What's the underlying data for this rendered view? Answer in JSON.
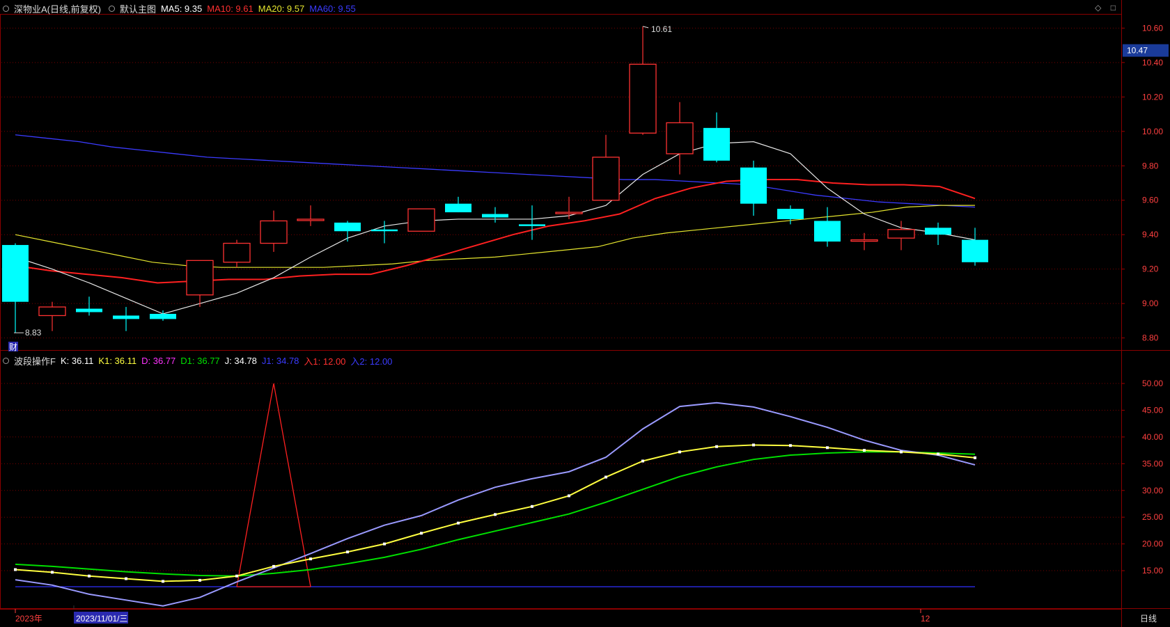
{
  "main_legend": {
    "title": "深物业A(日线,前复权)",
    "template": "默认主图",
    "ma5": "MA5: 9.35",
    "ma10": "MA10: 9.61",
    "ma20": "MA20: 9.57",
    "ma60": "MA60: 9.55"
  },
  "sub_legend": {
    "title": "波段操作F",
    "k": "K: 36.11",
    "k1": "K1: 36.11",
    "d": "D: 36.77",
    "d1": "D1: 36.77",
    "j": "J: 34.78",
    "j1": "J1: 34.78",
    "in1": "入1: 12.00",
    "in2": "入2: 12.00"
  },
  "corner_icons": [
    "diamond-icon",
    "square-icon"
  ],
  "colors": {
    "up": "#ff3232",
    "down": "#00ffff",
    "ma5": "#ffffff",
    "ma10": "#ff2020",
    "ma20": "#e6e62e",
    "ma60": "#3b3bff",
    "k": "#ffff40",
    "d": "#00e000",
    "j": "#9a9aff",
    "in1": "#ff2020",
    "in2": "#3030ff"
  },
  "annotations": {
    "high": "10.61",
    "low": "8.83",
    "finance_mark": "财",
    "current_price": "10.47"
  },
  "footer": {
    "year": "2023年",
    "date": "2023/11/01/三",
    "month": "12",
    "period": "日线"
  },
  "chart_data": [
    {
      "type": "candlestick",
      "ylim": [
        8.75,
        10.65
      ],
      "yticks": [
        "8.80",
        "9.00",
        "9.20",
        "9.40",
        "9.60",
        "9.80",
        "10.00",
        "10.20",
        "10.40",
        "10.60"
      ],
      "candles": [
        {
          "o": 9.34,
          "h": 9.35,
          "l": 8.83,
          "c": 9.01
        },
        {
          "o": 8.93,
          "h": 9.01,
          "l": 8.84,
          "c": 8.98
        },
        {
          "o": 8.97,
          "h": 9.04,
          "l": 8.93,
          "c": 8.95
        },
        {
          "o": 8.93,
          "h": 8.98,
          "l": 8.84,
          "c": 8.91
        },
        {
          "o": 8.94,
          "h": 8.96,
          "l": 8.9,
          "c": 8.91
        },
        {
          "o": 9.05,
          "h": 9.25,
          "l": 8.98,
          "c": 9.25
        },
        {
          "o": 9.24,
          "h": 9.37,
          "l": 9.21,
          "c": 9.35
        },
        {
          "o": 9.35,
          "h": 9.54,
          "l": 9.3,
          "c": 9.48
        },
        {
          "o": 9.49,
          "h": 9.57,
          "l": 9.45,
          "c": 9.49
        },
        {
          "o": 9.47,
          "h": 9.48,
          "l": 9.36,
          "c": 9.42
        },
        {
          "o": 9.43,
          "h": 9.48,
          "l": 9.35,
          "c": 9.42
        },
        {
          "o": 9.42,
          "h": 9.55,
          "l": 9.42,
          "c": 9.55
        },
        {
          "o": 9.58,
          "h": 9.62,
          "l": 9.53,
          "c": 9.53
        },
        {
          "o": 9.52,
          "h": 9.56,
          "l": 9.47,
          "c": 9.5
        },
        {
          "o": 9.46,
          "h": 9.57,
          "l": 9.37,
          "c": 9.45
        },
        {
          "o": 9.53,
          "h": 9.62,
          "l": 9.49,
          "c": 9.53
        },
        {
          "o": 9.6,
          "h": 9.98,
          "l": 9.6,
          "c": 9.85
        },
        {
          "o": 9.99,
          "h": 10.61,
          "l": 9.98,
          "c": 10.39
        },
        {
          "o": 9.87,
          "h": 10.17,
          "l": 9.75,
          "c": 10.05
        },
        {
          "o": 10.02,
          "h": 10.11,
          "l": 9.82,
          "c": 9.83
        },
        {
          "o": 9.79,
          "h": 9.83,
          "l": 9.51,
          "c": 9.58
        },
        {
          "o": 9.55,
          "h": 9.57,
          "l": 9.46,
          "c": 9.49
        },
        {
          "o": 9.48,
          "h": 9.56,
          "l": 9.33,
          "c": 9.36
        },
        {
          "o": 9.37,
          "h": 9.41,
          "l": 9.31,
          "c": 9.37
        },
        {
          "o": 9.38,
          "h": 9.48,
          "l": 9.31,
          "c": 9.43
        },
        {
          "o": 9.44,
          "h": 9.47,
          "l": 9.34,
          "c": 9.4
        },
        {
          "o": 9.37,
          "h": 9.44,
          "l": 9.22,
          "c": 9.24
        }
      ],
      "ma5": [
        9.27,
        9.2,
        9.12,
        9.03,
        8.94,
        9.0,
        9.06,
        9.15,
        9.27,
        9.38,
        9.45,
        9.48,
        9.49,
        9.49,
        9.49,
        9.51,
        9.57,
        9.75,
        9.87,
        9.93,
        9.94,
        9.87,
        9.67,
        9.52,
        9.44,
        9.41,
        9.37
      ],
      "ma10": [
        9.22,
        9.19,
        9.17,
        9.15,
        9.12,
        9.13,
        9.14,
        9.14,
        9.16,
        9.17,
        9.17,
        9.22,
        9.28,
        9.34,
        9.4,
        9.45,
        9.48,
        9.52,
        9.61,
        9.67,
        9.71,
        9.72,
        9.72,
        9.7,
        9.69,
        9.69,
        9.68,
        9.61
      ],
      "ma20": [
        9.4,
        9.36,
        9.32,
        9.28,
        9.24,
        9.22,
        9.21,
        9.21,
        9.21,
        9.21,
        9.22,
        9.23,
        9.25,
        9.26,
        9.27,
        9.29,
        9.31,
        9.33,
        9.38,
        9.41,
        9.43,
        9.45,
        9.47,
        9.49,
        9.51,
        9.53,
        9.56,
        9.57,
        9.57
      ],
      "ma60": [
        9.98,
        9.96,
        9.94,
        9.91,
        9.89,
        9.87,
        9.85,
        9.84,
        9.83,
        9.82,
        9.81,
        9.8,
        9.79,
        9.78,
        9.77,
        9.76,
        9.75,
        9.74,
        9.73,
        9.72,
        9.72,
        9.71,
        9.7,
        9.69,
        9.66,
        9.63,
        9.61,
        9.59,
        9.58,
        9.57,
        9.56
      ]
    },
    {
      "type": "line",
      "ylim": [
        8.5,
        53
      ],
      "yticks": [
        "15.00",
        "20.00",
        "25.00",
        "30.00",
        "35.00",
        "40.00",
        "45.00",
        "50.00"
      ],
      "series": [
        {
          "name": "K",
          "values": [
            15.2,
            14.7,
            14.0,
            13.5,
            13.0,
            13.2,
            14.0,
            15.8,
            17.2,
            18.5,
            20.0,
            22.0,
            23.9,
            25.5,
            27.0,
            29.0,
            32.5,
            35.5,
            37.2,
            38.2,
            38.5,
            38.4,
            38.0,
            37.5,
            37.2,
            36.8,
            36.11
          ]
        },
        {
          "name": "D",
          "values": [
            16.2,
            15.8,
            15.3,
            14.8,
            14.4,
            14.1,
            14.0,
            14.5,
            15.2,
            16.3,
            17.5,
            19.0,
            20.8,
            22.4,
            24.0,
            25.6,
            27.8,
            30.2,
            32.6,
            34.4,
            35.8,
            36.6,
            37.0,
            37.2,
            37.2,
            37.0,
            36.77
          ]
        },
        {
          "name": "J",
          "values": [
            13.3,
            12.3,
            10.6,
            9.5,
            8.4,
            10.0,
            12.9,
            15.5,
            18.2,
            21.0,
            23.5,
            25.3,
            28.2,
            30.6,
            32.2,
            33.5,
            36.2,
            41.5,
            45.7,
            46.4,
            45.6,
            43.8,
            41.8,
            39.4,
            37.5,
            36.6,
            34.78
          ]
        },
        {
          "name": "入1",
          "values": [
            12.0,
            12.0,
            12.0,
            12.0,
            12.0,
            12.0,
            12.0,
            50.0,
            12.0
          ]
        },
        {
          "name": "入2",
          "values": [
            12.0,
            12.0
          ]
        }
      ]
    }
  ]
}
